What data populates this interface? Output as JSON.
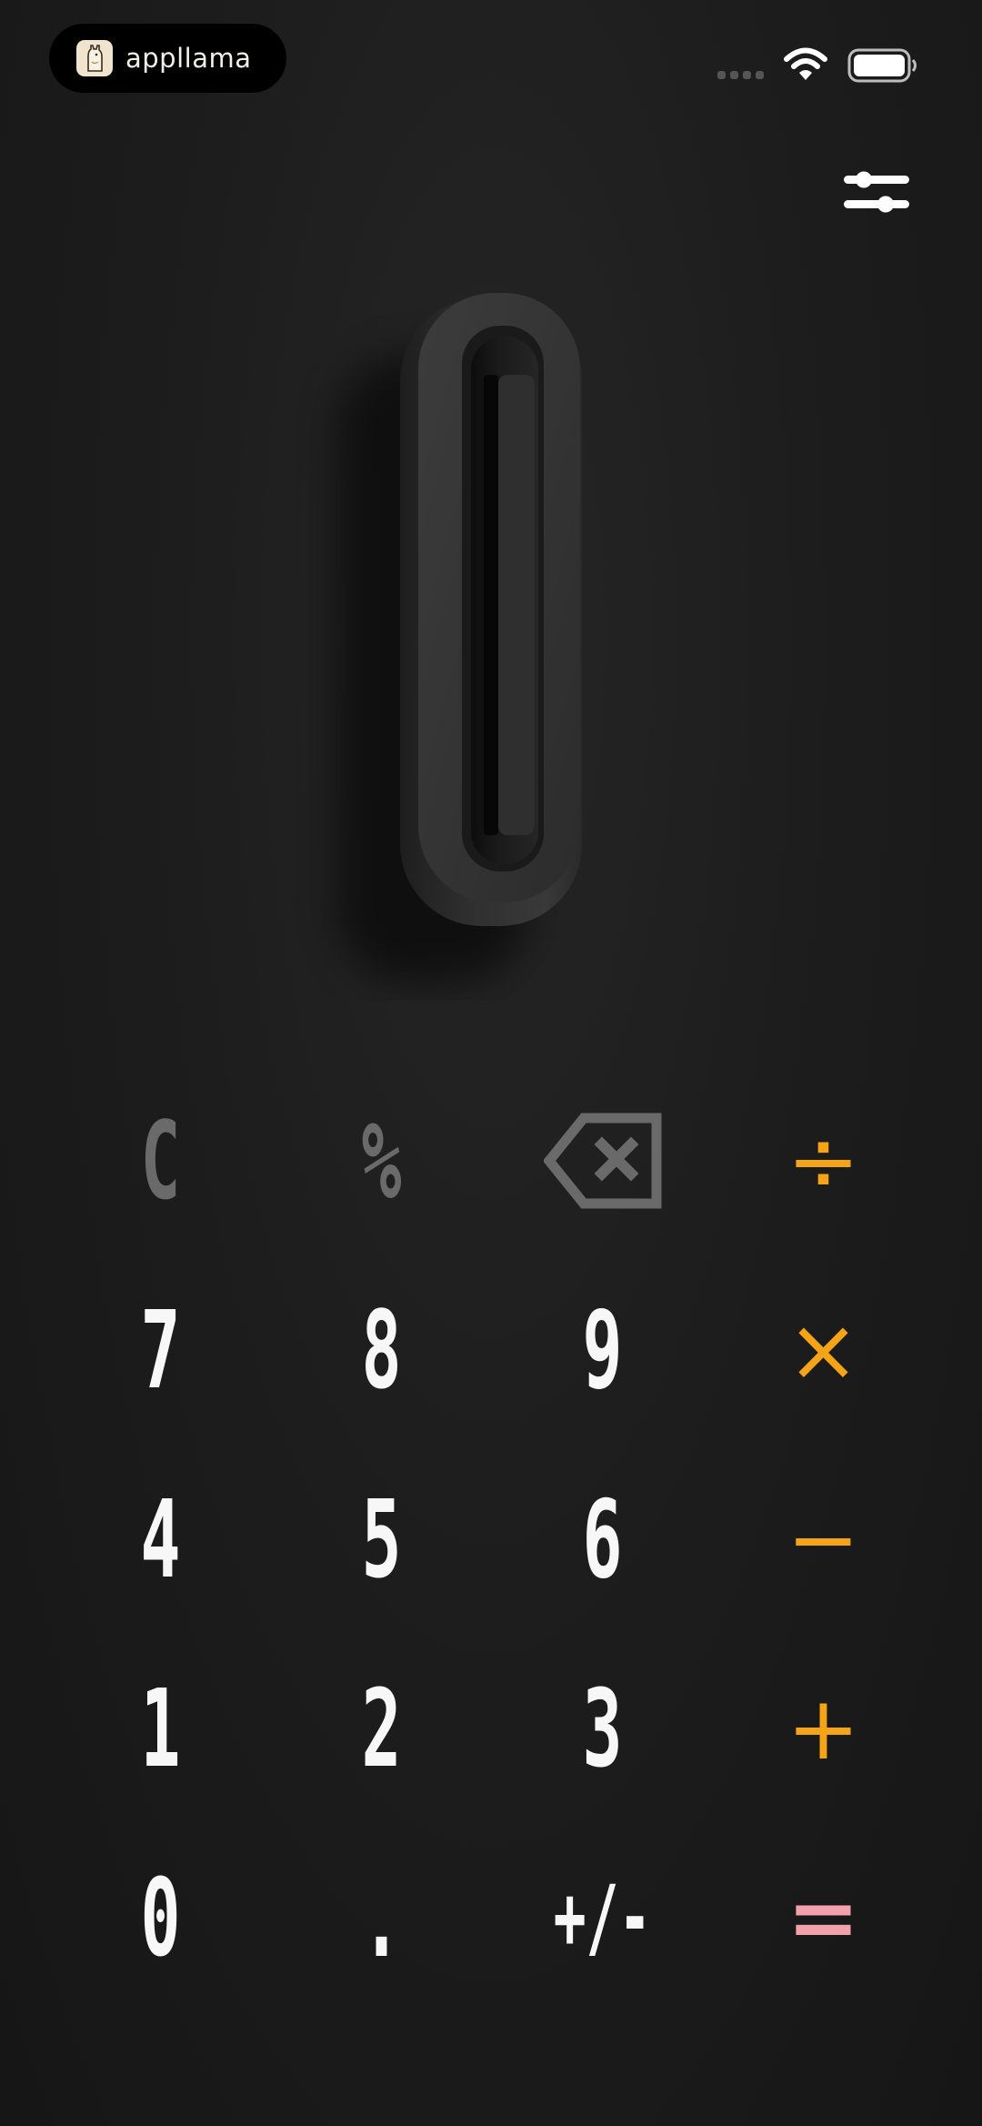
{
  "status_bar": {
    "brand": "appllama",
    "app_icon": "llama-icon",
    "wifi_icon": "wifi-icon",
    "battery_icon": "battery-icon",
    "signal_icon": "cellular-signal-icon"
  },
  "toolbar": {
    "settings_icon": "sliders-icon"
  },
  "display": {
    "value": "0"
  },
  "keypad": {
    "clear": "C",
    "percent": "%",
    "backspace_icon": "backspace-icon",
    "divide": "÷",
    "seven": "7",
    "eight": "8",
    "nine": "9",
    "multiply": "×",
    "four": "4",
    "five": "5",
    "six": "6",
    "minus": "−",
    "one": "1",
    "two": "2",
    "three": "3",
    "plus": "+",
    "zero": "0",
    "decimal": ".",
    "sign": "+/-",
    "equals": "="
  },
  "colors": {
    "background": "#1b1b1b",
    "operator": "#f5a417",
    "equals": "#f0a1a9",
    "utility": "#6a6a6a",
    "digit": "#f7f7f7"
  }
}
